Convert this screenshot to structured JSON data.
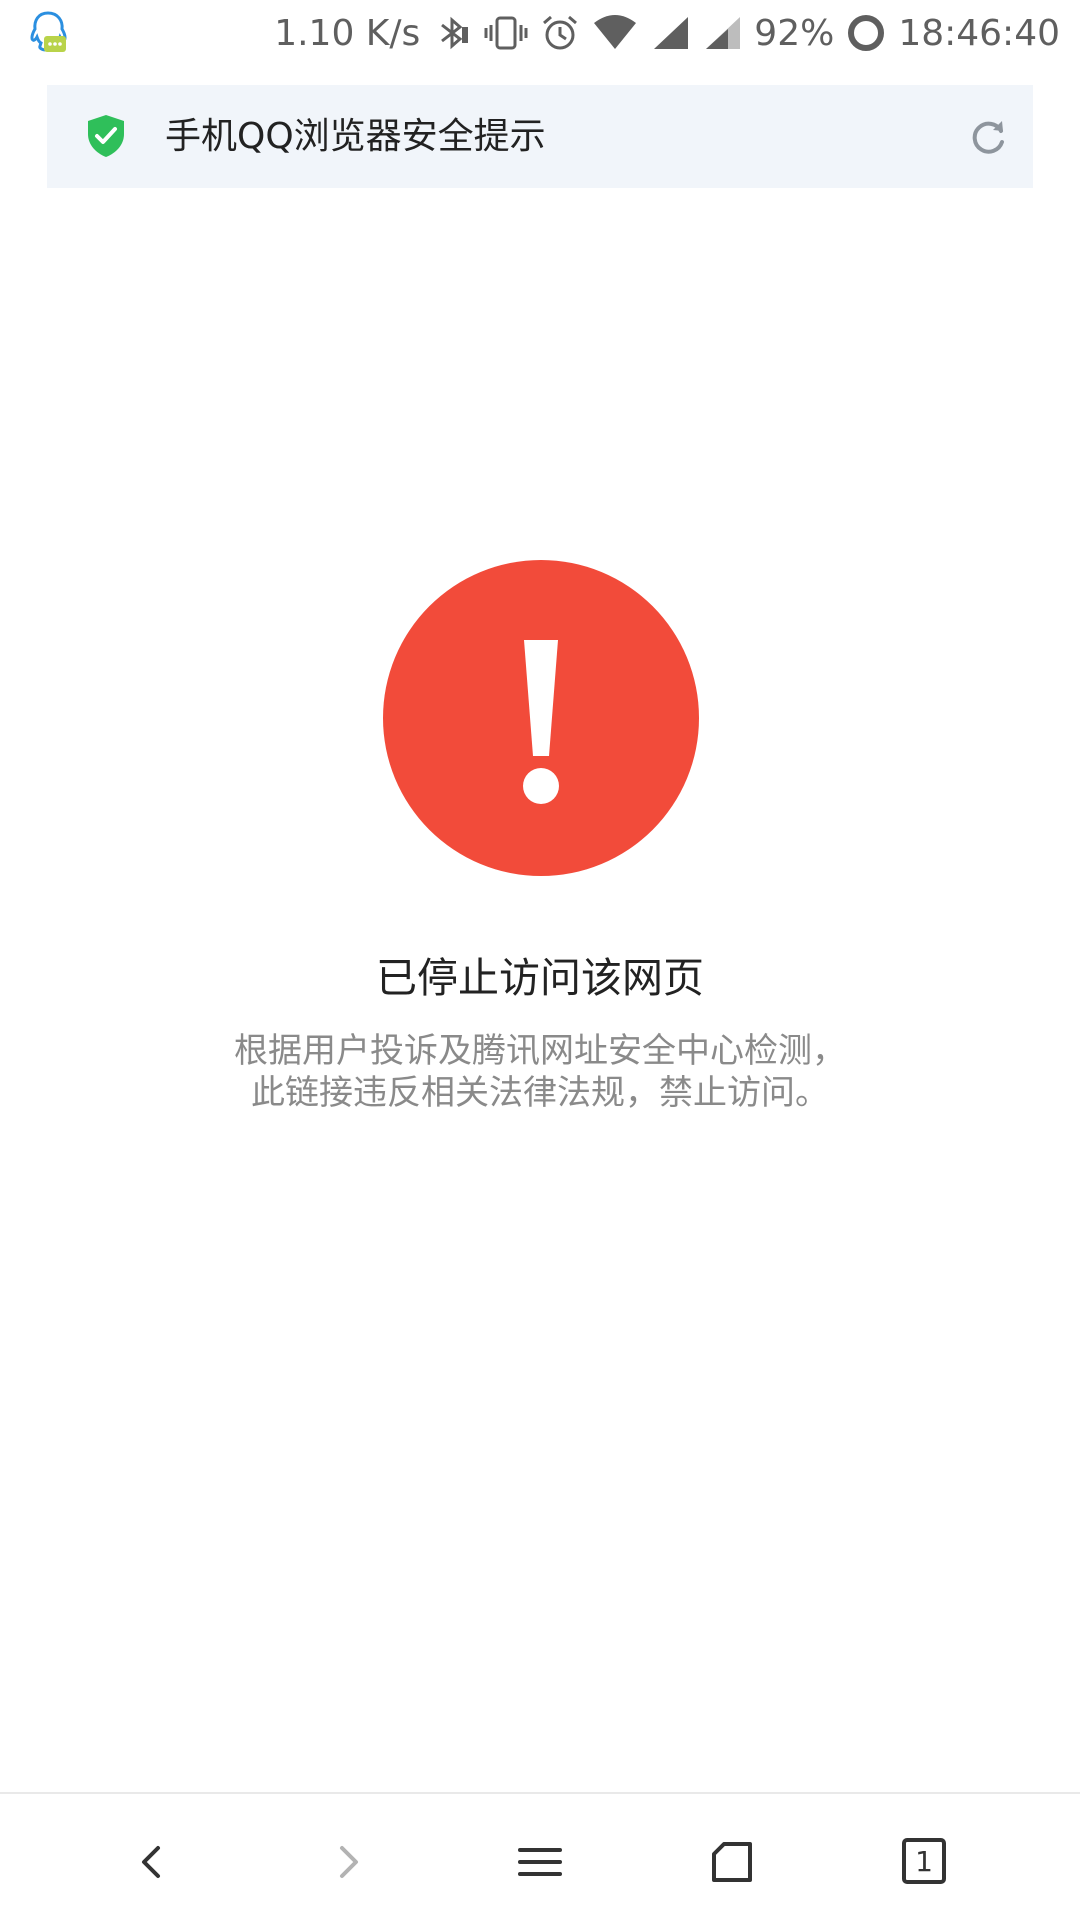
{
  "status_bar": {
    "app_icon": "qq-notification-icon",
    "net_speed": "1.10 K/s",
    "icons": [
      "bluetooth-icon",
      "vibrate-icon",
      "alarm-icon",
      "wifi-icon",
      "signal-icon",
      "signal-icon-2"
    ],
    "battery": "92%",
    "time": "18:46:40"
  },
  "title_bar": {
    "icon": "shield-check-icon",
    "title": "手机QQ浏览器安全提示",
    "refresh_icon": "refresh-icon"
  },
  "warning": {
    "icon": "exclamation-circle-icon",
    "title": "已停止访问该网页",
    "desc_line1": "根据用户投诉及腾讯网址安全中心检测，",
    "desc_line2": "此链接违反相关法律法规，禁止访问。"
  },
  "toolbar": {
    "back_icon": "back-arrow-icon",
    "forward_icon": "forward-arrow-icon",
    "menu_icon": "menu-icon",
    "home_icon": "home-icon",
    "tabs_count": "1"
  },
  "colors": {
    "accent_red": "#f24b3a",
    "shield_green": "#2fbf5a",
    "title_bar_bg": "#f1f5fa",
    "desc_text": "#8a8a8a"
  }
}
